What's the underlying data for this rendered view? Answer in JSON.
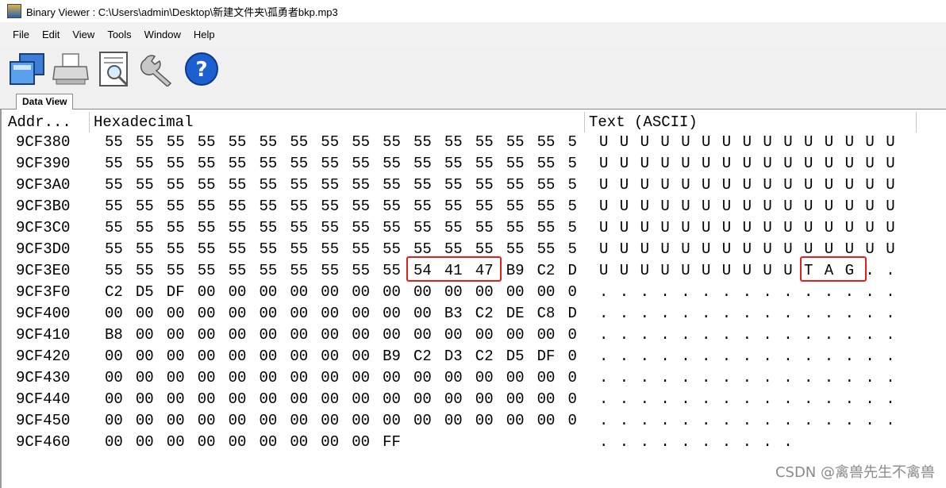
{
  "window": {
    "title": "Binary Viewer : C:\\Users\\admin\\Desktop\\新建文件夹\\孤勇者bkp.mp3"
  },
  "menu": [
    "File",
    "Edit",
    "View",
    "Tools",
    "Window",
    "Help"
  ],
  "toolbar": {
    "buttons": [
      "open-icon",
      "print-icon",
      "preview-icon",
      "settings-wrench-icon",
      "help-icon"
    ]
  },
  "tab": {
    "label": "Data View"
  },
  "columns": {
    "addr": "Addr...",
    "hex": "Hexadecimal",
    "text": "Text (ASCII)"
  },
  "rows": [
    {
      "addr": "9CF380",
      "hex": [
        "55",
        "55",
        "55",
        "55",
        "55",
        "55",
        "55",
        "55",
        "55",
        "55",
        "55",
        "55",
        "55",
        "55",
        "55",
        "5"
      ],
      "text": [
        "U",
        "U",
        "U",
        "U",
        "U",
        "U",
        "U",
        "U",
        "U",
        "U",
        "U",
        "U",
        "U",
        "U",
        "U"
      ]
    },
    {
      "addr": "9CF390",
      "hex": [
        "55",
        "55",
        "55",
        "55",
        "55",
        "55",
        "55",
        "55",
        "55",
        "55",
        "55",
        "55",
        "55",
        "55",
        "55",
        "5"
      ],
      "text": [
        "U",
        "U",
        "U",
        "U",
        "U",
        "U",
        "U",
        "U",
        "U",
        "U",
        "U",
        "U",
        "U",
        "U",
        "U"
      ]
    },
    {
      "addr": "9CF3A0",
      "hex": [
        "55",
        "55",
        "55",
        "55",
        "55",
        "55",
        "55",
        "55",
        "55",
        "55",
        "55",
        "55",
        "55",
        "55",
        "55",
        "5"
      ],
      "text": [
        "U",
        "U",
        "U",
        "U",
        "U",
        "U",
        "U",
        "U",
        "U",
        "U",
        "U",
        "U",
        "U",
        "U",
        "U"
      ]
    },
    {
      "addr": "9CF3B0",
      "hex": [
        "55",
        "55",
        "55",
        "55",
        "55",
        "55",
        "55",
        "55",
        "55",
        "55",
        "55",
        "55",
        "55",
        "55",
        "55",
        "5"
      ],
      "text": [
        "U",
        "U",
        "U",
        "U",
        "U",
        "U",
        "U",
        "U",
        "U",
        "U",
        "U",
        "U",
        "U",
        "U",
        "U"
      ]
    },
    {
      "addr": "9CF3C0",
      "hex": [
        "55",
        "55",
        "55",
        "55",
        "55",
        "55",
        "55",
        "55",
        "55",
        "55",
        "55",
        "55",
        "55",
        "55",
        "55",
        "5"
      ],
      "text": [
        "U",
        "U",
        "U",
        "U",
        "U",
        "U",
        "U",
        "U",
        "U",
        "U",
        "U",
        "U",
        "U",
        "U",
        "U"
      ]
    },
    {
      "addr": "9CF3D0",
      "hex": [
        "55",
        "55",
        "55",
        "55",
        "55",
        "55",
        "55",
        "55",
        "55",
        "55",
        "55",
        "55",
        "55",
        "55",
        "55",
        "5"
      ],
      "text": [
        "U",
        "U",
        "U",
        "U",
        "U",
        "U",
        "U",
        "U",
        "U",
        "U",
        "U",
        "U",
        "U",
        "U",
        "U"
      ]
    },
    {
      "addr": "9CF3E0",
      "hex": [
        "55",
        "55",
        "55",
        "55",
        "55",
        "55",
        "55",
        "55",
        "55",
        "55",
        "54",
        "41",
        "47",
        "B9",
        "C2",
        "D"
      ],
      "text": [
        "U",
        "U",
        "U",
        "U",
        "U",
        "U",
        "U",
        "U",
        "U",
        "U",
        "T",
        "A",
        "G",
        ".",
        "."
      ]
    },
    {
      "addr": "9CF3F0",
      "hex": [
        "C2",
        "D5",
        "DF",
        "00",
        "00",
        "00",
        "00",
        "00",
        "00",
        "00",
        "00",
        "00",
        "00",
        "00",
        "00",
        "0"
      ],
      "text": [
        ".",
        ".",
        ".",
        ".",
        ".",
        ".",
        ".",
        ".",
        ".",
        ".",
        ".",
        ".",
        ".",
        ".",
        "."
      ]
    },
    {
      "addr": "9CF400",
      "hex": [
        "00",
        "00",
        "00",
        "00",
        "00",
        "00",
        "00",
        "00",
        "00",
        "00",
        "00",
        "B3",
        "C2",
        "DE",
        "C8",
        "D"
      ],
      "text": [
        ".",
        ".",
        ".",
        ".",
        ".",
        ".",
        ".",
        ".",
        ".",
        ".",
        ".",
        ".",
        ".",
        ".",
        "."
      ]
    },
    {
      "addr": "9CF410",
      "hex": [
        "B8",
        "00",
        "00",
        "00",
        "00",
        "00",
        "00",
        "00",
        "00",
        "00",
        "00",
        "00",
        "00",
        "00",
        "00",
        "0"
      ],
      "text": [
        ".",
        ".",
        ".",
        ".",
        ".",
        ".",
        ".",
        ".",
        ".",
        ".",
        ".",
        ".",
        ".",
        ".",
        "."
      ]
    },
    {
      "addr": "9CF420",
      "hex": [
        "00",
        "00",
        "00",
        "00",
        "00",
        "00",
        "00",
        "00",
        "00",
        "B9",
        "C2",
        "D3",
        "C2",
        "D5",
        "DF",
        "0"
      ],
      "text": [
        ".",
        ".",
        ".",
        ".",
        ".",
        ".",
        ".",
        ".",
        ".",
        ".",
        ".",
        ".",
        ".",
        ".",
        "."
      ]
    },
    {
      "addr": "9CF430",
      "hex": [
        "00",
        "00",
        "00",
        "00",
        "00",
        "00",
        "00",
        "00",
        "00",
        "00",
        "00",
        "00",
        "00",
        "00",
        "00",
        "0"
      ],
      "text": [
        ".",
        ".",
        ".",
        ".",
        ".",
        ".",
        ".",
        ".",
        ".",
        ".",
        ".",
        ".",
        ".",
        ".",
        "."
      ]
    },
    {
      "addr": "9CF440",
      "hex": [
        "00",
        "00",
        "00",
        "00",
        "00",
        "00",
        "00",
        "00",
        "00",
        "00",
        "00",
        "00",
        "00",
        "00",
        "00",
        "0"
      ],
      "text": [
        ".",
        ".",
        ".",
        ".",
        ".",
        ".",
        ".",
        ".",
        ".",
        ".",
        ".",
        ".",
        ".",
        ".",
        "."
      ]
    },
    {
      "addr": "9CF450",
      "hex": [
        "00",
        "00",
        "00",
        "00",
        "00",
        "00",
        "00",
        "00",
        "00",
        "00",
        "00",
        "00",
        "00",
        "00",
        "00",
        "0"
      ],
      "text": [
        ".",
        ".",
        ".",
        ".",
        ".",
        ".",
        ".",
        ".",
        ".",
        ".",
        ".",
        ".",
        ".",
        ".",
        "."
      ]
    },
    {
      "addr": "9CF460",
      "hex": [
        "00",
        "00",
        "00",
        "00",
        "00",
        "00",
        "00",
        "00",
        "00",
        "FF"
      ],
      "text": [
        ".",
        ".",
        ".",
        ".",
        ".",
        ".",
        ".",
        ".",
        ".",
        "."
      ]
    }
  ],
  "highlight": {
    "hex": [
      "54",
      "41",
      "47"
    ],
    "ascii": [
      "T",
      "A",
      "G"
    ],
    "color": "#e02020"
  },
  "watermark": "CSDN @禽兽先生不禽兽"
}
